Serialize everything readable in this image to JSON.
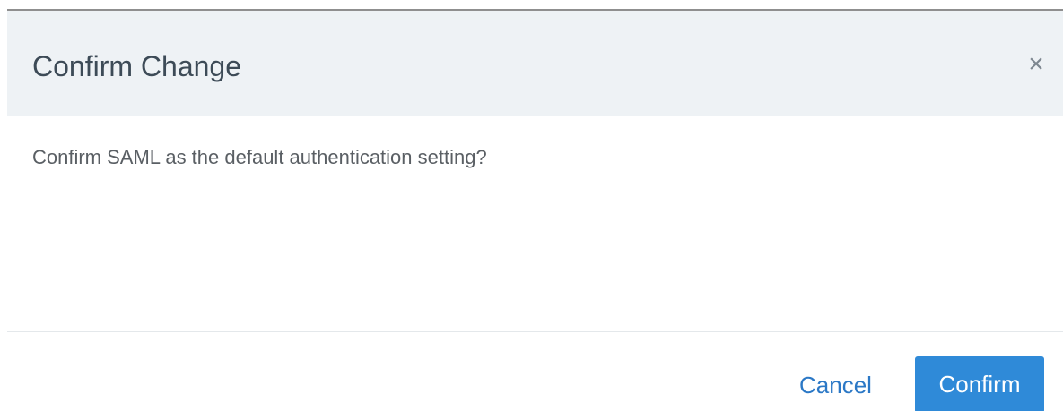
{
  "dialog": {
    "title": "Confirm Change",
    "close_glyph": "×",
    "close_icon": "close-icon",
    "message": "Confirm SAML as the default authentication setting?",
    "cancel_label": "Cancel",
    "confirm_label": "Confirm"
  },
  "colors": {
    "header_background": "#eef2f5",
    "primary_button": "#2f8ad8",
    "link_text": "#2b78c6"
  }
}
